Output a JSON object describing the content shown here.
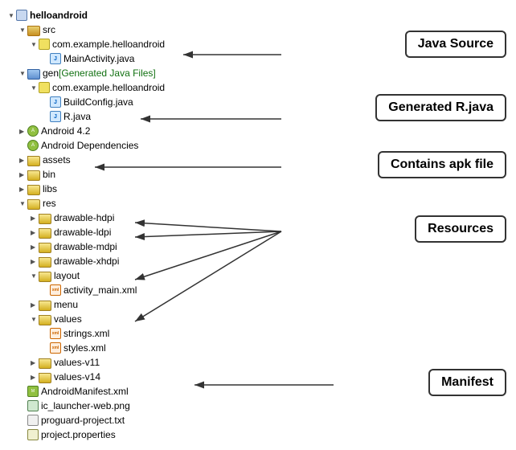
{
  "tree": {
    "items": [
      {
        "id": "helloandroid",
        "indent": 0,
        "arrow": "▼",
        "icon": "project",
        "label": "helloandroid",
        "bold": true
      },
      {
        "id": "src",
        "indent": 1,
        "arrow": "▼",
        "icon": "folder-src",
        "label": "src",
        "bold": false
      },
      {
        "id": "com-src",
        "indent": 2,
        "arrow": "▼",
        "icon": "pkg",
        "label": "com.example.helloandroid",
        "bold": false
      },
      {
        "id": "mainactivity",
        "indent": 3,
        "arrow": " ",
        "icon": "java",
        "label": "MainActivity.java",
        "bold": false
      },
      {
        "id": "gen",
        "indent": 1,
        "arrow": "▼",
        "icon": "folder-gen",
        "label": "gen",
        "bold": false,
        "suffix": " [Generated Java Files]",
        "suffixColor": "green"
      },
      {
        "id": "com-gen",
        "indent": 2,
        "arrow": "▼",
        "icon": "pkg",
        "label": "com.example.helloandroid",
        "bold": false
      },
      {
        "id": "buildconfig",
        "indent": 3,
        "arrow": " ",
        "icon": "java",
        "label": "BuildConfig.java",
        "bold": false
      },
      {
        "id": "r-java",
        "indent": 3,
        "arrow": " ",
        "icon": "java",
        "label": "R.java",
        "bold": false
      },
      {
        "id": "android42",
        "indent": 1,
        "arrow": "▶",
        "icon": "android",
        "label": "Android 4.2",
        "bold": false
      },
      {
        "id": "androiddeps",
        "indent": 1,
        "arrow": " ",
        "icon": "android",
        "label": "Android Dependencies",
        "bold": false
      },
      {
        "id": "assets",
        "indent": 1,
        "arrow": "▶",
        "icon": "folder-plain",
        "label": "assets",
        "bold": false
      },
      {
        "id": "bin",
        "indent": 1,
        "arrow": "▶",
        "icon": "folder-plain",
        "label": "bin",
        "bold": false
      },
      {
        "id": "libs",
        "indent": 1,
        "arrow": "▶",
        "icon": "folder-plain",
        "label": "libs",
        "bold": false
      },
      {
        "id": "res",
        "indent": 1,
        "arrow": "▼",
        "icon": "folder-plain",
        "label": "res",
        "bold": false
      },
      {
        "id": "drawable-hdpi",
        "indent": 2,
        "arrow": "▶",
        "icon": "folder-drawable",
        "label": "drawable-hdpi",
        "bold": false
      },
      {
        "id": "drawable-ldpi",
        "indent": 2,
        "arrow": "▶",
        "icon": "folder-drawable",
        "label": "drawable-ldpi",
        "bold": false
      },
      {
        "id": "drawable-mdpi",
        "indent": 2,
        "arrow": "▶",
        "icon": "folder-drawable",
        "label": "drawable-mdpi",
        "bold": false
      },
      {
        "id": "drawable-xhdpi",
        "indent": 2,
        "arrow": "▶",
        "icon": "folder-drawable",
        "label": "drawable-xhdpi",
        "bold": false
      },
      {
        "id": "layout",
        "indent": 2,
        "arrow": "▼",
        "icon": "folder-plain",
        "label": "layout",
        "bold": false
      },
      {
        "id": "activity-main",
        "indent": 3,
        "arrow": " ",
        "icon": "xml",
        "label": "activity_main.xml",
        "bold": false
      },
      {
        "id": "menu",
        "indent": 2,
        "arrow": "▶",
        "icon": "folder-plain",
        "label": "menu",
        "bold": false
      },
      {
        "id": "values",
        "indent": 2,
        "arrow": "▼",
        "icon": "folder-plain",
        "label": "values",
        "bold": false
      },
      {
        "id": "strings-xml",
        "indent": 3,
        "arrow": " ",
        "icon": "xml",
        "label": "strings.xml",
        "bold": false
      },
      {
        "id": "styles-xml",
        "indent": 3,
        "arrow": " ",
        "icon": "xml",
        "label": "styles.xml",
        "bold": false
      },
      {
        "id": "values-v11",
        "indent": 2,
        "arrow": "▶",
        "icon": "folder-plain",
        "label": "values-v11",
        "bold": false
      },
      {
        "id": "values-v14",
        "indent": 2,
        "arrow": "▶",
        "icon": "folder-plain",
        "label": "values-v14",
        "bold": false
      },
      {
        "id": "androidmanifest",
        "indent": 1,
        "arrow": " ",
        "icon": "manifest",
        "label": "AndroidManifest.xml",
        "bold": false
      },
      {
        "id": "ic-launcher",
        "indent": 1,
        "arrow": " ",
        "icon": "image",
        "label": "ic_launcher-web.png",
        "bold": false
      },
      {
        "id": "proguard",
        "indent": 1,
        "arrow": " ",
        "icon": "txt",
        "label": "proguard-project.txt",
        "bold": false
      },
      {
        "id": "project-props",
        "indent": 1,
        "arrow": " ",
        "icon": "props",
        "label": "project.properties",
        "bold": false
      }
    ]
  },
  "callouts": {
    "java_source": "Java Source",
    "generated_rjava": "Generated R.java",
    "contains_apk": "Contains apk file",
    "resources": "Resources",
    "manifest": "Manifest"
  }
}
